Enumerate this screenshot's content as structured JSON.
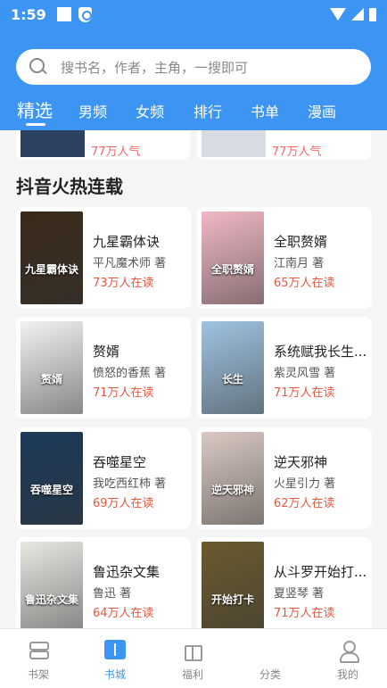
{
  "status_bar": {
    "time": "1:59"
  },
  "search": {
    "placeholder": "搜书名，作者，主角，一搜即可"
  },
  "tabs": [
    {
      "label": "精选",
      "active": true
    },
    {
      "label": "男频",
      "active": false
    },
    {
      "label": "女频",
      "active": false
    },
    {
      "label": "排行",
      "active": false
    },
    {
      "label": "书单",
      "active": false
    },
    {
      "label": "漫画",
      "active": false
    }
  ],
  "previous_section": {
    "cards": [
      {
        "reads": "77万人气"
      },
      {
        "reads": "77万人气"
      }
    ]
  },
  "section": {
    "title": "抖音火热连载",
    "books": [
      {
        "title": "九星霸体诀",
        "author": "平凡魔术师 著",
        "reads": "73万人在读",
        "cover_text": "九星霸体诀",
        "cover_color": "#3a2a1a"
      },
      {
        "title": "全职赘婿",
        "author": "江南月 著",
        "reads": "65万人在读",
        "cover_text": "全职赘婿",
        "cover_color": "#f0b8c4"
      },
      {
        "title": "赘婿",
        "author": "愤怒的香蕉 著",
        "reads": "71万人在读",
        "cover_text": "赘婿",
        "cover_color": "#f2f2f2"
      },
      {
        "title": "系统赋我长生...",
        "author": "紫灵风雪 著",
        "reads": "71万人在读",
        "cover_text": "长生",
        "cover_color": "#9fc3e0"
      },
      {
        "title": "吞噬星空",
        "author": "我吃西红柿 著",
        "reads": "69万人在读",
        "cover_text": "吞噬星空",
        "cover_color": "#1c3a5a"
      },
      {
        "title": "逆天邪神",
        "author": "火星引力 著",
        "reads": "62万人在读",
        "cover_text": "逆天邪神",
        "cover_color": "#d9c9c2"
      },
      {
        "title": "鲁迅杂文集",
        "author": "鲁迅 著",
        "reads": "64万人在读",
        "cover_text": "鲁迅杂文集",
        "cover_color": "#e9e7e2"
      },
      {
        "title": "从斗罗开始打...",
        "author": "夏竖琴 著",
        "reads": "71万人在读",
        "cover_text": "开始打卡",
        "cover_color": "#6a5a2e"
      }
    ]
  },
  "bottom_nav": [
    {
      "label": "书架",
      "icon": "bookshelf-icon",
      "active": false
    },
    {
      "label": "书城",
      "icon": "book-store-icon",
      "active": true
    },
    {
      "label": "福利",
      "icon": "gift-icon",
      "active": false
    },
    {
      "label": "分类",
      "icon": "category-grid-icon",
      "active": false
    },
    {
      "label": "我的",
      "icon": "user-icon",
      "active": false
    }
  ],
  "colors": {
    "primary": "#3d95f3",
    "reads": "#e9573f",
    "background": "#f4f5f7"
  }
}
